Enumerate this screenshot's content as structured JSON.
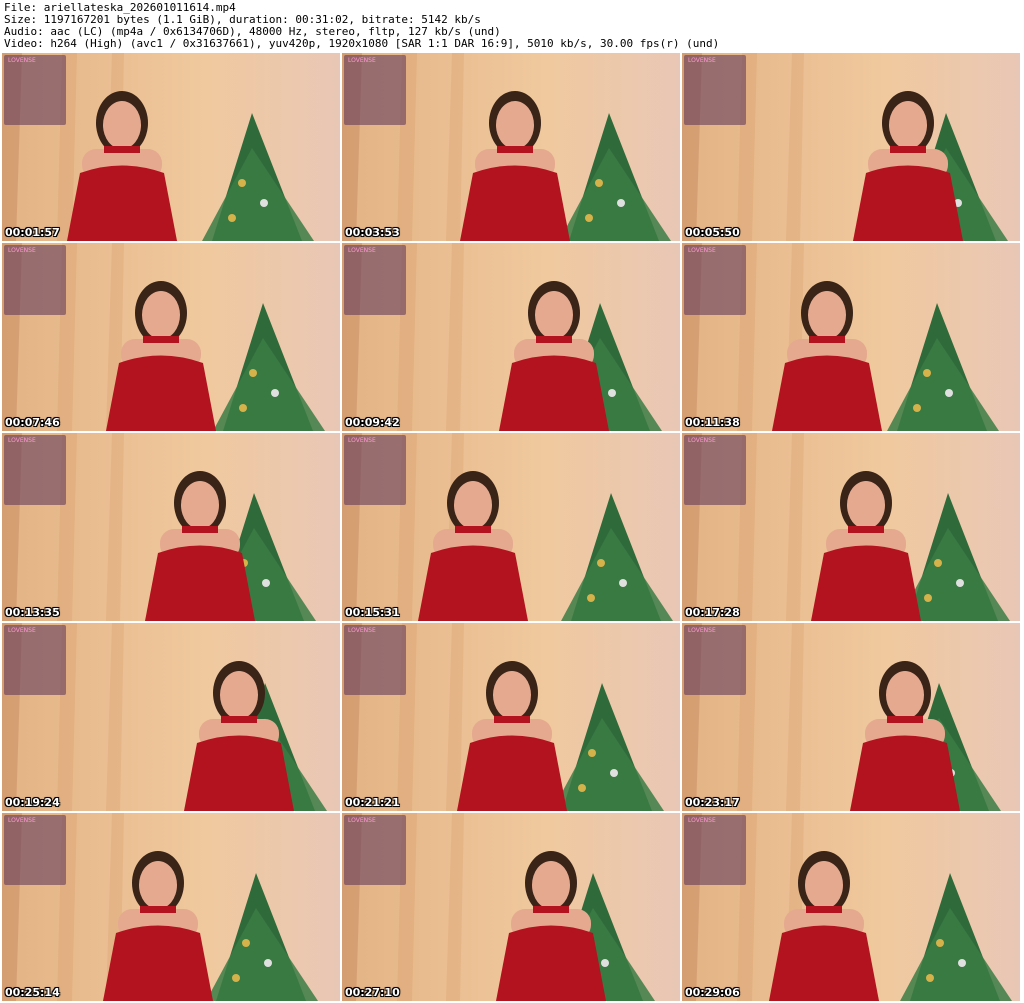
{
  "header": {
    "file": "File: ariellateska_202601011614.mp4",
    "size": "Size: 1197167201 bytes (1.1 GiB), duration: 00:31:02, bitrate: 5142 kb/s",
    "audio": "Audio: aac (LC) (mp4a / 0x6134706D), 48000 Hz, stereo, fltp, 127 kb/s (und)",
    "video": "Video: h264 (High) (avc1 / 0x31637661), yuv420p, 1920x1080 [SAR 1:1 DAR 16:9], 5010 kb/s, 30.00 fps(r) (und)"
  },
  "overlay_brand": "LOVENSE",
  "thumbnails": [
    {
      "timestamp": "00:01:57"
    },
    {
      "timestamp": "00:03:53"
    },
    {
      "timestamp": "00:05:50"
    },
    {
      "timestamp": "00:07:46"
    },
    {
      "timestamp": "00:09:42"
    },
    {
      "timestamp": "00:11:38"
    },
    {
      "timestamp": "00:13:35"
    },
    {
      "timestamp": "00:15:31"
    },
    {
      "timestamp": "00:17:28"
    },
    {
      "timestamp": "00:19:24"
    },
    {
      "timestamp": "00:21:21"
    },
    {
      "timestamp": "00:23:17"
    },
    {
      "timestamp": "00:25:14"
    },
    {
      "timestamp": "00:27:10"
    },
    {
      "timestamp": "00:29:06"
    }
  ],
  "colors": {
    "dress": "#b3121f",
    "curtain": "#e3b384",
    "wall": "#e9c7b6",
    "tree": "#2f6b3a",
    "skin": "#e5a98f",
    "hair": "#3a2418"
  }
}
